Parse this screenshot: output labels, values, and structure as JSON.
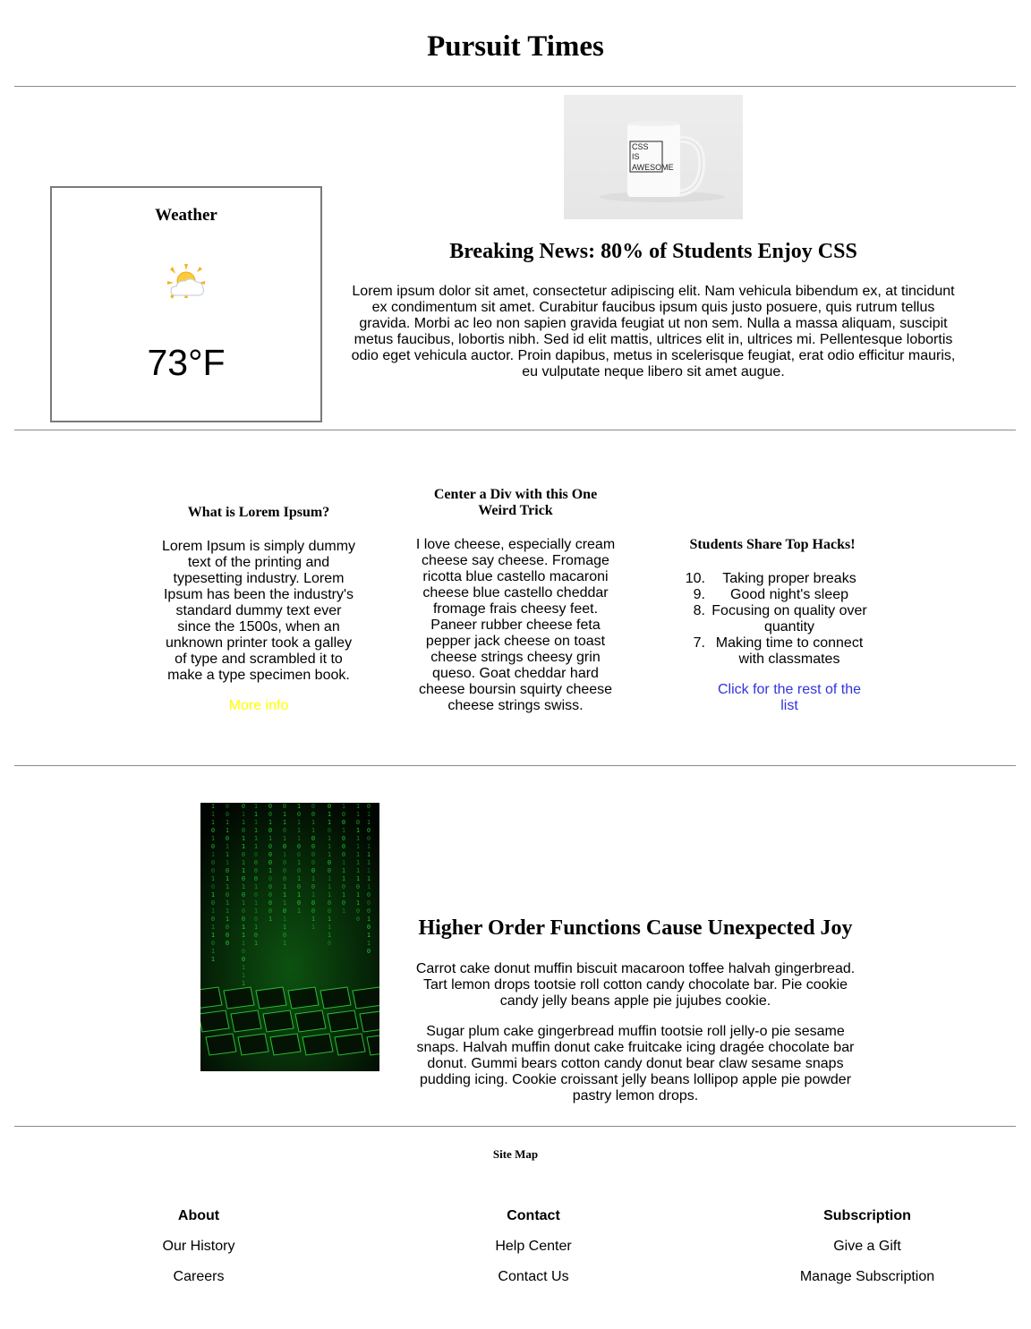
{
  "header": {
    "title": "Pursuit Times"
  },
  "weather": {
    "title": "Weather",
    "icon": "partly-sunny-icon",
    "temperature": "73°F"
  },
  "mug": {
    "icon": "mug-image",
    "text_lines": [
      "CSS",
      "IS",
      "AWESOME"
    ]
  },
  "breaking": {
    "title": "Breaking News: 80% of Students Enjoy CSS",
    "body": "Lorem ipsum dolor sit amet, consectetur adipiscing elit. Nam vehicula bibendum ex, at tincidunt ex condimentum sit amet. Curabitur faucibus ipsum quis justo posuere, quis rutrum tellus gravida. Morbi ac leo non sapien gravida feugiat ut non sem. Nulla a massa aliquam, suscipit metus faucibus, lobortis nibh. Sed id elit mattis, ultrices elit in, ultrices mi. Pellentesque lobortis odio eget vehicula auctor. Proin dapibus, metus in scelerisque feugiat, erat odio efficitur mauris, eu vulputate neque libero sit amet augue."
  },
  "columns": {
    "lorem": {
      "title": "What is Lorem Ipsum?",
      "body": "Lorem Ipsum is simply dummy text of the printing and typesetting industry. Lorem Ipsum has been the industry's standard dummy text ever since the 1500s, when an unknown printer took a galley of type and scrambled it to make a type specimen book.",
      "link": "More info",
      "link_color": "#ffff00"
    },
    "center_div": {
      "title": "Center a Div with this One Weird Trick",
      "body": "I love cheese, especially cream cheese say cheese. Fromage ricotta blue castello macaroni cheese blue castello cheddar fromage frais cheesy feet. Paneer rubber cheese feta pepper jack cheese on toast cheese strings cheesy grin queso. Goat cheddar hard cheese boursin squirty cheese cheese strings swiss."
    },
    "hacks": {
      "title": "Students Share Top Hacks!",
      "items": [
        {
          "number": "10.",
          "text": "Taking proper breaks"
        },
        {
          "number": "9.",
          "text": "Good night's sleep"
        },
        {
          "number": "8.",
          "text": "Focusing on quality over quantity"
        },
        {
          "number": "7.",
          "text": "Making time to connect with classmates"
        }
      ],
      "link": "Click for the rest of the list",
      "link_color": "#3333dd"
    }
  },
  "feature": {
    "image": "matrix-keyboard-image",
    "title": "Higher Order Functions Cause Unexpected Joy",
    "paragraph1": "Carrot cake donut muffin biscuit macaroon toffee halvah gingerbread. Tart lemon drops tootsie roll cotton candy chocolate bar. Pie cookie candy jelly beans apple pie jujubes cookie.",
    "paragraph2": "Sugar plum cake gingerbread muffin tootsie roll jelly-o pie sesame snaps. Halvah muffin donut cake fruitcake icing dragée chocolate bar donut. Gummi bears cotton candy donut bear claw sesame snaps pudding icing. Cookie croissant jelly beans lollipop apple pie powder pastry lemon drops."
  },
  "footer": {
    "sitemap_label": "Site Map",
    "columns": [
      {
        "heading": "About",
        "links": [
          "Our History",
          "Careers"
        ]
      },
      {
        "heading": "Contact",
        "links": [
          "Help Center",
          "Contact Us"
        ]
      },
      {
        "heading": "Subscription",
        "links": [
          "Give a Gift",
          "Manage Subscription"
        ]
      }
    ]
  },
  "colors": {
    "rule": "#8a8a8a",
    "matrix_green": "#22cc33"
  }
}
